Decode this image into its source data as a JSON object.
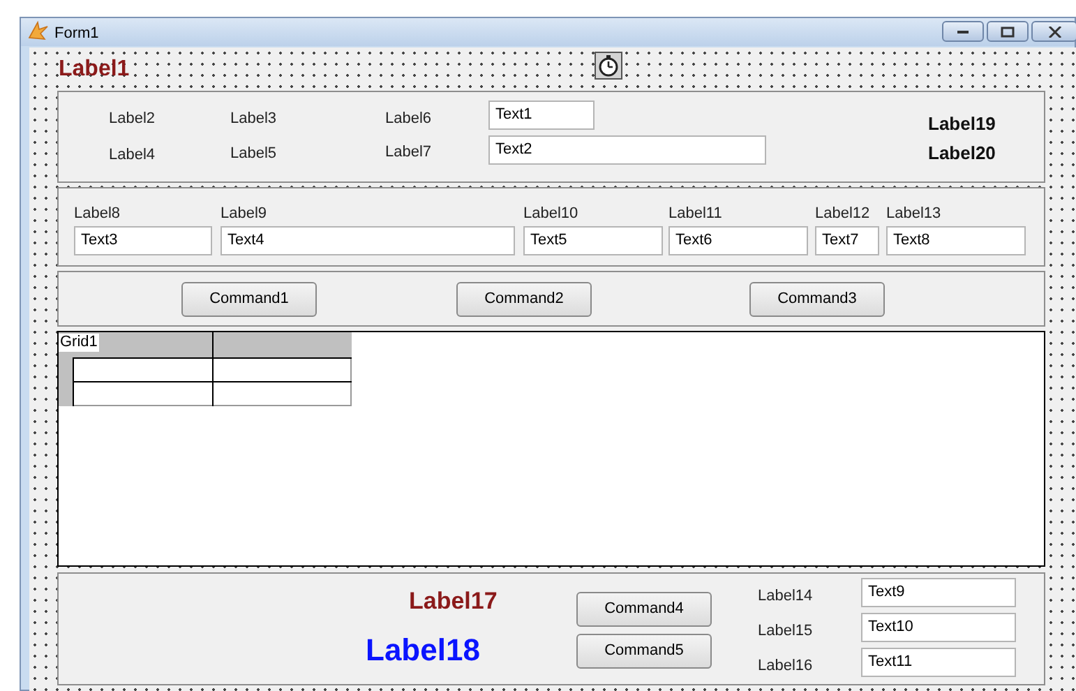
{
  "window": {
    "title": "Form1"
  },
  "header": {
    "label": "Label1"
  },
  "frame_1": {
    "labels": [
      "Label2",
      "Label3",
      "Label6",
      "Label4",
      "Label5",
      "Label7"
    ],
    "fields": [
      "Text1",
      "Text2"
    ],
    "totals": [
      "Label19",
      "Label20"
    ]
  },
  "frame_2": {
    "columns": [
      {
        "label": "Label8",
        "field": "Text3"
      },
      {
        "label": "Label9",
        "field": "Text4"
      },
      {
        "label": "Label10",
        "field": "Text5"
      },
      {
        "label": "Label11",
        "field": "Text6"
      },
      {
        "label": "Label12",
        "field": "Text7"
      },
      {
        "label": "Label13",
        "field": "Text8"
      }
    ]
  },
  "frame_3": {
    "buttons": [
      "Command1",
      "Command2",
      "Command3"
    ]
  },
  "grid": {
    "caption": "Grid1"
  },
  "frame_4": {
    "labels": [
      {
        "text": "Label17",
        "color": "#8b1a1a"
      },
      {
        "text": "Label18",
        "color": "#0a14ff"
      }
    ],
    "buttons": [
      "Command4",
      "Command5"
    ],
    "fields": [
      {
        "label": "Label14",
        "value": "Text9"
      },
      {
        "label": "Label15",
        "value": "Text10"
      },
      {
        "label": "Label16",
        "value": "Text11"
      }
    ]
  }
}
